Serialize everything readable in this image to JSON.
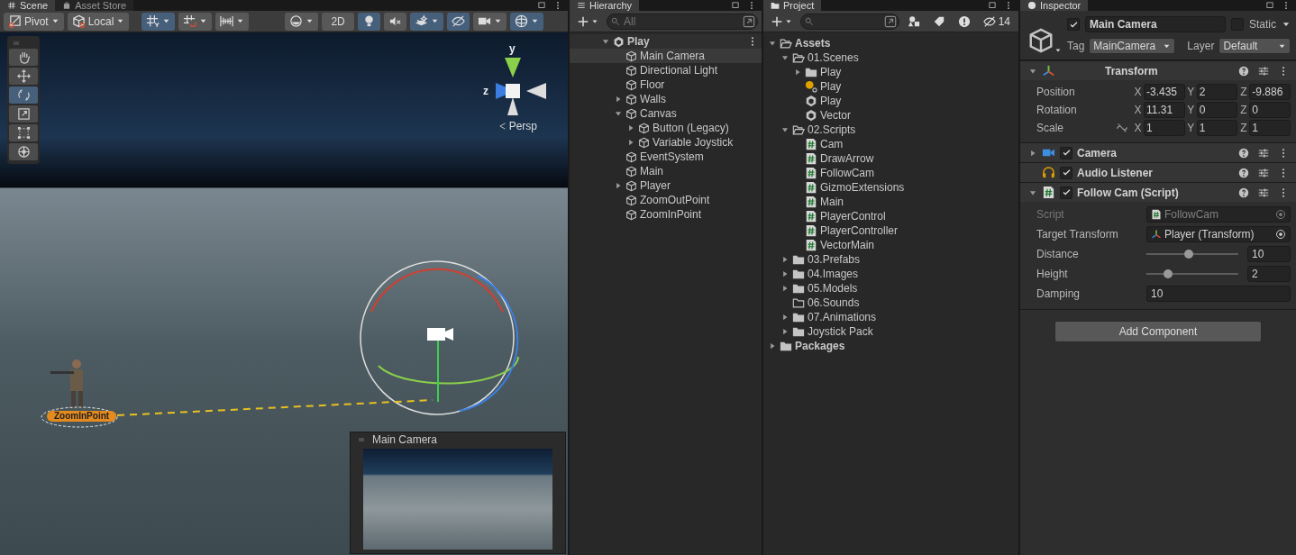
{
  "scene": {
    "tabs": [
      {
        "label": "Scene",
        "selected": true
      },
      {
        "label": "Asset Store",
        "selected": false
      }
    ],
    "toolbar_groups": [
      [
        {
          "label": "Pivot",
          "dropdown": true,
          "selected": false
        },
        {
          "label": "Local",
          "dropdown": true,
          "selected": false
        }
      ],
      [
        {
          "dropdown": true,
          "selected": true
        },
        {
          "dropdown": true,
          "selected": false
        },
        {
          "dropdown": true,
          "selected": false
        }
      ],
      [
        {
          "dropdown": true,
          "selected": false
        },
        {
          "label": "2D",
          "selected": false
        },
        {
          "selected": true
        },
        {
          "selected": false
        },
        {
          "dropdown": true,
          "selected": true
        },
        {
          "selected": true
        },
        {
          "dropdown": true,
          "selected": false
        },
        {
          "dropdown": true,
          "selected": true
        }
      ]
    ],
    "tools": [
      {
        "selected": false
      },
      {
        "selected": false
      },
      {
        "selected": true
      },
      {
        "selected": false
      },
      {
        "selected": false
      },
      {
        "selected": false
      }
    ],
    "gizmo": {
      "y_label": "y",
      "z_label": "z",
      "projection": "Persp"
    },
    "waypoint_label": "ZoomInPoint",
    "preview": {
      "title": "Main Camera"
    }
  },
  "hierarchy": {
    "title": "Hierarchy",
    "search_placeholder": "All",
    "scene": {
      "label": "Play",
      "expanded": true
    },
    "items": [
      {
        "label": "Main Camera",
        "selected": true
      },
      {
        "label": "Directional Light",
        "selected": false
      },
      {
        "label": "Floor",
        "selected": false
      },
      {
        "label": "Walls",
        "selected": false,
        "expanded": false
      },
      {
        "label": "Canvas",
        "selected": false,
        "expanded": true,
        "children": [
          {
            "label": "Button (Legacy)",
            "selected": false,
            "expanded": false
          },
          {
            "label": "Variable Joystick",
            "selected": false,
            "expanded": false
          }
        ]
      },
      {
        "label": "EventSystem",
        "selected": false
      },
      {
        "label": "Main",
        "selected": false
      },
      {
        "label": "Player",
        "selected": false,
        "expanded": false
      },
      {
        "label": "ZoomOutPoint",
        "selected": false
      },
      {
        "label": "ZoomInPoint",
        "selected": false
      }
    ]
  },
  "project": {
    "title": "Project",
    "hidden_count": "14",
    "tree": [
      {
        "label": "Assets",
        "kind": "folder",
        "expanded": true,
        "children": [
          {
            "label": "01.Scenes",
            "kind": "folder",
            "expanded": true,
            "children": [
              {
                "label": "Play",
                "kind": "folder",
                "expanded": false
              },
              {
                "label": "Play",
                "kind": "lighting"
              },
              {
                "label": "Play",
                "kind": "scene"
              },
              {
                "label": "Vector",
                "kind": "scene"
              }
            ]
          },
          {
            "label": "02.Scripts",
            "kind": "folder",
            "expanded": true,
            "children": [
              {
                "label": "Cam",
                "kind": "script"
              },
              {
                "label": "DrawArrow",
                "kind": "script"
              },
              {
                "label": "FollowCam",
                "kind": "script"
              },
              {
                "label": "GizmoExtensions",
                "kind": "script"
              },
              {
                "label": "Main",
                "kind": "script"
              },
              {
                "label": "PlayerControl",
                "kind": "script"
              },
              {
                "label": "PlayerController",
                "kind": "script"
              },
              {
                "label": "VectorMain",
                "kind": "script"
              }
            ]
          },
          {
            "label": "03.Prefabs",
            "kind": "folder",
            "expanded": false
          },
          {
            "label": "04.Images",
            "kind": "folder",
            "expanded": false
          },
          {
            "label": "05.Models",
            "kind": "folder",
            "expanded": false
          },
          {
            "label": "06.Sounds",
            "kind": "empty-folder"
          },
          {
            "label": "07.Animations",
            "kind": "folder",
            "expanded": false
          },
          {
            "label": "Joystick Pack",
            "kind": "folder",
            "expanded": false
          }
        ]
      },
      {
        "label": "Packages",
        "kind": "folder",
        "expanded": false
      }
    ]
  },
  "inspector": {
    "title": "Inspector",
    "active": true,
    "name": "Main Camera",
    "static": false,
    "static_label": "Static",
    "tag_label": "Tag",
    "tag": "MainCamera",
    "layer_label": "Layer",
    "layer": "Default",
    "components": [
      {
        "kind": "transform",
        "title": "Transform",
        "expanded": true,
        "rows": [
          {
            "label": "Position",
            "fields": [
              {
                "axis": "X",
                "value": "-3.435"
              },
              {
                "axis": "Y",
                "value": "2"
              },
              {
                "axis": "Z",
                "value": "-9.886"
              }
            ]
          },
          {
            "label": "Rotation",
            "fields": [
              {
                "axis": "X",
                "value": "11.31"
              },
              {
                "axis": "Y",
                "value": "0"
              },
              {
                "axis": "Z",
                "value": "0"
              }
            ]
          },
          {
            "label": "Scale",
            "constrain_icon": true,
            "fields": [
              {
                "axis": "X",
                "value": "1"
              },
              {
                "axis": "Y",
                "value": "1"
              },
              {
                "axis": "Z",
                "value": "1"
              }
            ]
          }
        ]
      },
      {
        "kind": "camera",
        "title": "Camera",
        "expanded": false,
        "enabled": true
      },
      {
        "kind": "audio",
        "title": "Audio Listener",
        "enabled": true
      },
      {
        "kind": "script",
        "title": "Follow Cam (Script)",
        "expanded": true,
        "enabled": true,
        "properties": [
          {
            "kind": "object",
            "label": "Script",
            "value": "FollowCam",
            "disabled": true
          },
          {
            "kind": "object",
            "label": "Target Transform",
            "value": "Player (Transform)",
            "disabled": false
          },
          {
            "kind": "slider",
            "label": "Distance",
            "level": 0.46,
            "value": "10"
          },
          {
            "kind": "slider",
            "label": "Height",
            "level": 0.24,
            "value": "2"
          },
          {
            "kind": "number",
            "label": "Damping",
            "value": "10"
          }
        ]
      }
    ],
    "add_button": "Add Component"
  }
}
